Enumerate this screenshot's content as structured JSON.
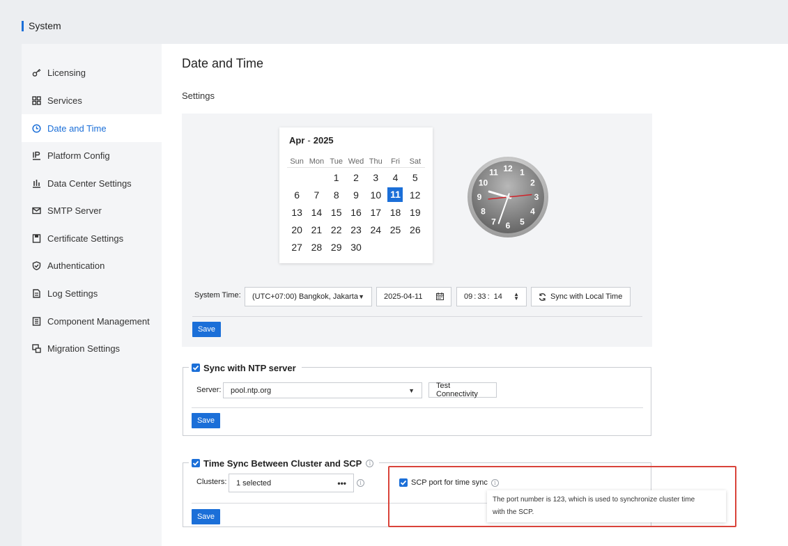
{
  "header": {
    "title": "System",
    "accent_color": "#1b6fd8"
  },
  "sidebar": {
    "items": [
      {
        "label": "Licensing",
        "icon": "key-icon",
        "active": false
      },
      {
        "label": "Services",
        "icon": "grid-icon",
        "active": false
      },
      {
        "label": "Date and Time",
        "icon": "clock-icon",
        "active": true
      },
      {
        "label": "Platform Config",
        "icon": "ip-icon",
        "active": false
      },
      {
        "label": "Data Center Settings",
        "icon": "bar-chart-icon",
        "active": false
      },
      {
        "label": "SMTP Server",
        "icon": "mail-icon",
        "active": false
      },
      {
        "label": "Certificate Settings",
        "icon": "certificate-icon",
        "active": false
      },
      {
        "label": "Authentication",
        "icon": "shield-icon",
        "active": false
      },
      {
        "label": "Log Settings",
        "icon": "log-file-icon",
        "active": false
      },
      {
        "label": "Component Management",
        "icon": "component-icon",
        "active": false
      },
      {
        "label": "Migration Settings",
        "icon": "migration-icon",
        "active": false
      }
    ]
  },
  "main": {
    "title": "Date and Time",
    "settings_label": "Settings",
    "calendar": {
      "month": "Apr",
      "separator": "-",
      "year": "2025",
      "weekdays": [
        "Sun",
        "Mon",
        "Tue",
        "Wed",
        "Thu",
        "Fri",
        "Sat"
      ],
      "weeks": [
        [
          "",
          "",
          "1",
          "2",
          "3",
          "4",
          "5"
        ],
        [
          "6",
          "7",
          "8",
          "9",
          "10",
          "11",
          "12"
        ],
        [
          "13",
          "14",
          "15",
          "16",
          "17",
          "18",
          "19"
        ],
        [
          "20",
          "21",
          "22",
          "23",
          "24",
          "25",
          "26"
        ],
        [
          "27",
          "28",
          "29",
          "30",
          "",
          "",
          ""
        ]
      ],
      "selected_day": "11"
    },
    "clock": {
      "hours": 9,
      "minutes": 33,
      "seconds": 14,
      "numerals": [
        "12",
        "1",
        "2",
        "3",
        "4",
        "5",
        "6",
        "7",
        "8",
        "9",
        "10",
        "11"
      ],
      "second_hand_color": "#d0232a"
    },
    "system_time": {
      "label": "System Time:",
      "timezone": "(UTC+07:00) Bangkok, Jakarta",
      "date": "2025-04-11",
      "time_hh": "09",
      "time_mm": "33",
      "time_ss": "14",
      "sync_label": "Sync with Local Time",
      "save_label": "Save"
    },
    "ntp": {
      "legend": "Sync with NTP server",
      "checked": true,
      "server_label": "Server:",
      "server_value": "pool.ntp.org",
      "test_label": "Test Connectivity",
      "save_label": "Save"
    },
    "cluster_sync": {
      "legend": "Time Sync Between Cluster and SCP",
      "checked": true,
      "clusters_label": "Clusters:",
      "clusters_value": "1 selected",
      "scp_port_label": "SCP port for time sync",
      "scp_port_checked": true,
      "tooltip_line1": "The port number is 123, which is used to synchronize cluster time",
      "tooltip_line2": "with the SCP.",
      "save_label": "Save"
    }
  },
  "colors": {
    "primary": "#1b6fd8",
    "highlight_border": "#d9433a"
  }
}
